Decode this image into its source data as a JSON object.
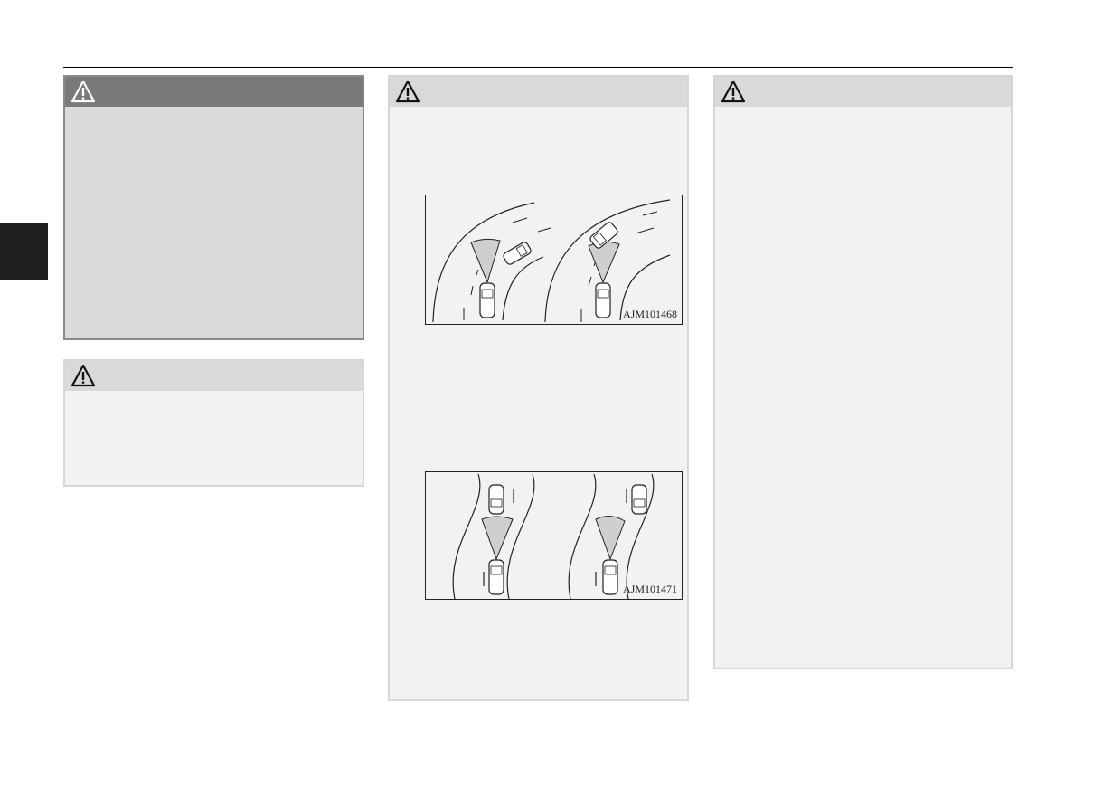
{
  "page": {
    "warning_icon": "warning-triangle-icon"
  },
  "figures": {
    "curve_figure_code": "AJM101468",
    "lane_figure_code": "AJM101471"
  },
  "colors": {
    "dark_header": "#7a7a7a",
    "light_header": "#d9d9d9",
    "box_fill": "#f2f2f2",
    "side_tab": "#1e1e1e"
  }
}
